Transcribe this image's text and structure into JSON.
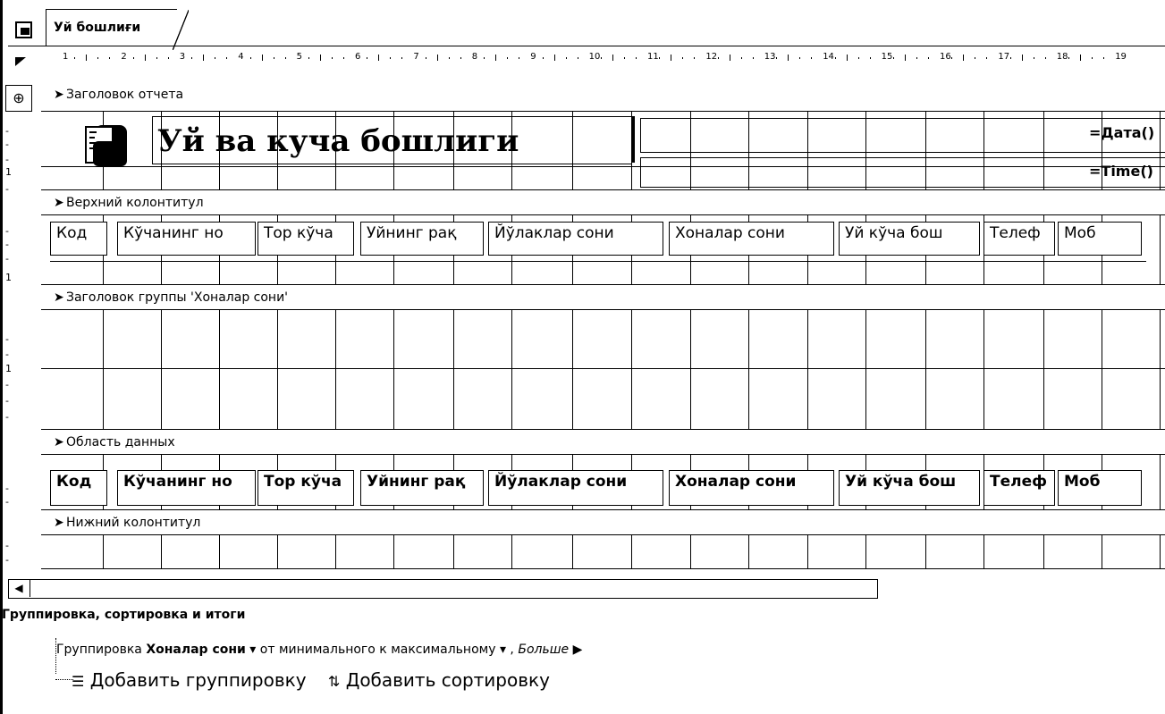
{
  "tab": {
    "title": "Уй бошлиғи"
  },
  "ruler": {
    "ticks": [
      "1",
      "2",
      "3",
      "4",
      "5",
      "6",
      "7",
      "8",
      "9",
      "10",
      "11",
      "12",
      "13",
      "14",
      "15",
      "16",
      "17",
      "18",
      "19"
    ]
  },
  "sections": {
    "report_header": "Заголовок отчета",
    "page_header": "Верхний колонтитул",
    "group_header": "Заголовок группы 'Хоналар сони'",
    "detail": "Область данных",
    "page_footer": "Нижний колонтитул"
  },
  "report": {
    "title": "Уй ва куча бошлиги",
    "date_expr": "=Дата()",
    "time_expr": "=Time()"
  },
  "columns": [
    {
      "header": "Код",
      "field": "Код"
    },
    {
      "header": "Кўчанинг но",
      "field": "Кўчанинг но"
    },
    {
      "header": "Тор кўча",
      "field": "Тор кўча"
    },
    {
      "header": "Уйнинг рақ",
      "field": "Уйнинг рақ"
    },
    {
      "header": "Йўлаклар сони",
      "field": "Йўлаклар сони"
    },
    {
      "header": "Хоналар сони",
      "field": "Хоналар сони"
    },
    {
      "header": "Уй кўча бош",
      "field": "Уй кўча бош"
    },
    {
      "header": "Телеф",
      "field": "Телеф"
    },
    {
      "header": "Моб",
      "field": "Моб"
    }
  ],
  "grouping": {
    "panel_title": "Группировка, сортировка и итоги",
    "group_prefix": "Группировка",
    "group_field": "Хоналар сони",
    "order": "от минимального к максимальному",
    "more": "Больше",
    "add_group": "Добавить группировку",
    "add_sort": "Добавить сортировку"
  },
  "icons": {
    "document": "report-icon",
    "ruler_corner": "ruler-corner-icon",
    "select": "report-selector-icon",
    "section_arrow": "section-arrow-icon",
    "add_group": "add-group-icon",
    "add_sort": "sort-icon"
  }
}
